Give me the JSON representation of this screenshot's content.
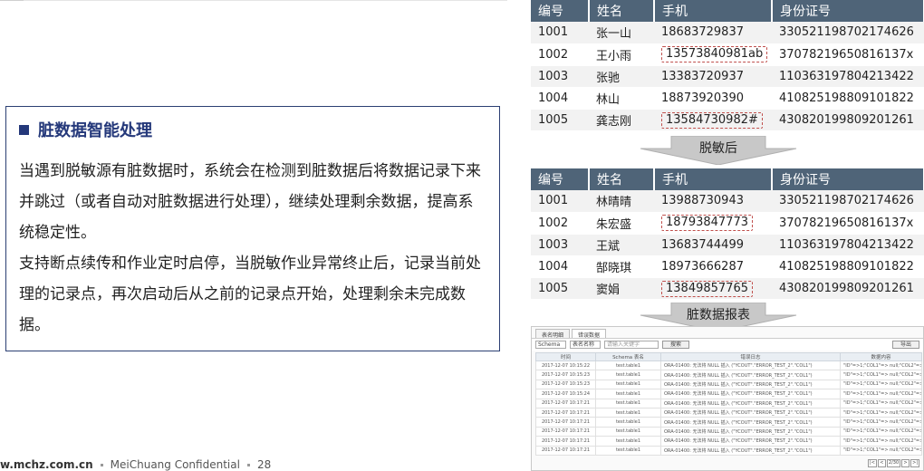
{
  "info": {
    "title": "脏数据智能处理",
    "para1": "当遇到脱敏源有脏数据时，系统会在检测到脏数据后将数据记录下来并跳过（或者自动对脏数据进行处理），继续处理剩余数据，提高系统稳定性。",
    "para2": "支持断点续传和作业定时启停，当脱敏作业异常终止后，记录当前处理的记录点，再次启动后从之前的记录点开始，处理剩余未完成数据。"
  },
  "footer": {
    "site": "w.mchz.com.cn",
    "confidential": "MeiChuang Confidential",
    "page": "28"
  },
  "table_before": {
    "headers": [
      "编号",
      "姓名",
      "手机",
      "身份证号"
    ],
    "rows": [
      [
        "1001",
        "张一山",
        "18683729837",
        "330521198702174626"
      ],
      [
        "1002",
        "王小雨",
        "13573840981ab",
        "37078219650816137x"
      ],
      [
        "1003",
        "张驰",
        "13383720937",
        "110363197804213422"
      ],
      [
        "1004",
        "林山",
        "18873920390",
        "410825198809101822"
      ],
      [
        "1005",
        "龚志刚",
        "13584730982#",
        "430820199809201261"
      ]
    ]
  },
  "arrow1": {
    "label": "脱敏后"
  },
  "table_after": {
    "headers": [
      "编号",
      "姓名",
      "手机",
      "身份证号"
    ],
    "rows": [
      [
        "1001",
        "林晴晴",
        "13988730943",
        "330521198702174626"
      ],
      [
        "1002",
        "朱宏盛",
        "18793847773",
        "37078219650816137x"
      ],
      [
        "1003",
        "王斌",
        "13683744499",
        "110363197804213422"
      ],
      [
        "1004",
        "郜晓琪",
        "18973666287",
        "410825198809101822"
      ],
      [
        "1005",
        "窦娟",
        "13849857765",
        "430820199809201261"
      ]
    ]
  },
  "arrow2": {
    "label": "脏数据报表"
  },
  "report": {
    "tabs": [
      "表名明细",
      "错误数据"
    ],
    "schema_select": "Schema",
    "table_select": "表名名称",
    "search_placeholder": "请输入关键字",
    "search_button": "搜索",
    "export_button": "导出",
    "headers": [
      "时间",
      "Schema 表名",
      "错误日志",
      "数据内容"
    ],
    "rows": [
      [
        "2017-12-07 10:15:22",
        "test.table1",
        "ORA-01400: 无法将 NULL 插入 (\"YCOUT\".\"ERROR_TEST_2\".\"COL1\")",
        "\"ID\"=>1;\"COL1\"=> null;\"COL2\"=>null"
      ],
      [
        "2017-12-07 10:15:23",
        "test.table1",
        "ORA-01400: 无法将 NULL 插入 (\"YCOUT\".\"ERROR_TEST_2\".\"COL1\")",
        "\"ID\"=>1;\"COL1\"=> null;\"COL2\"=>null"
      ],
      [
        "2017-12-07 10:15:23",
        "test.table1",
        "ORA-01400: 无法将 NULL 插入 (\"YCOUT\".\"ERROR_TEST_2\".\"COL1\")",
        "\"ID\"=>1;\"COL1\"=> null;\"COL2\"=>null"
      ],
      [
        "2017-12-07 10:15:24",
        "test.table1",
        "ORA-01400: 无法将 NULL 插入 (\"YCOUT\".\"ERROR_TEST_2\".\"COL1\")",
        "\"ID\"=>1;\"COL1\"=> null;\"COL2\"=>null"
      ],
      [
        "2017-12-07 10:17:21",
        "test.table1",
        "ORA-01400: 无法将 NULL 插入 (\"YCOUT\".\"ERROR_TEST_2\".\"COL1\")",
        "\"ID\"=>1;\"COL1\"=> null;\"COL2\"=>null"
      ],
      [
        "2017-12-07 10:17:21",
        "test.table1",
        "ORA-01400: 无法将 NULL 插入 (\"YCOUT\".\"ERROR_TEST_2\".\"COL1\")",
        "\"ID\"=>1;\"COL1\"=> null;\"COL2\"=>null"
      ],
      [
        "2017-12-07 10:17:21",
        "test.table1",
        "ORA-01400: 无法将 NULL 插入 (\"YCOUT\".\"ERROR_TEST_2\".\"COL1\")",
        "\"ID\"=>1;\"COL1\"=> null;\"COL2\"=>null"
      ],
      [
        "2017-12-07 10:17:21",
        "test.table1",
        "ORA-01400: 无法将 NULL 插入 (\"YCOUT\".\"ERROR_TEST_2\".\"COL1\")",
        "\"ID\"=>1;\"COL1\"=> null;\"COL2\"=>null"
      ],
      [
        "2017-12-07 10:17:21",
        "test.table1",
        "ORA-01400: 无法将 NULL 插入 (\"YCOUT\".\"ERROR_TEST_2\".\"COL1\")",
        "\"ID\"=>1;\"COL1\"=> null;\"COL2\"=>null"
      ],
      [
        "2017-12-07 10:17:21",
        "test.table1",
        "ORA-01400: 无法将 NULL 插入 (\"YCOUT\".\"ERROR_TEST_2\".\"COL1\")",
        "\"ID\"=>1;\"COL1\"=> null;\"COL2\"=>null"
      ]
    ],
    "pager": [
      "|<",
      "<",
      "2/30",
      ">",
      ">|"
    ]
  },
  "colors": {
    "header_bg": "#4f6478",
    "title_blue": "#24387a",
    "highlight": "#c0504d",
    "arrow_fill": "#c8c8c8"
  }
}
